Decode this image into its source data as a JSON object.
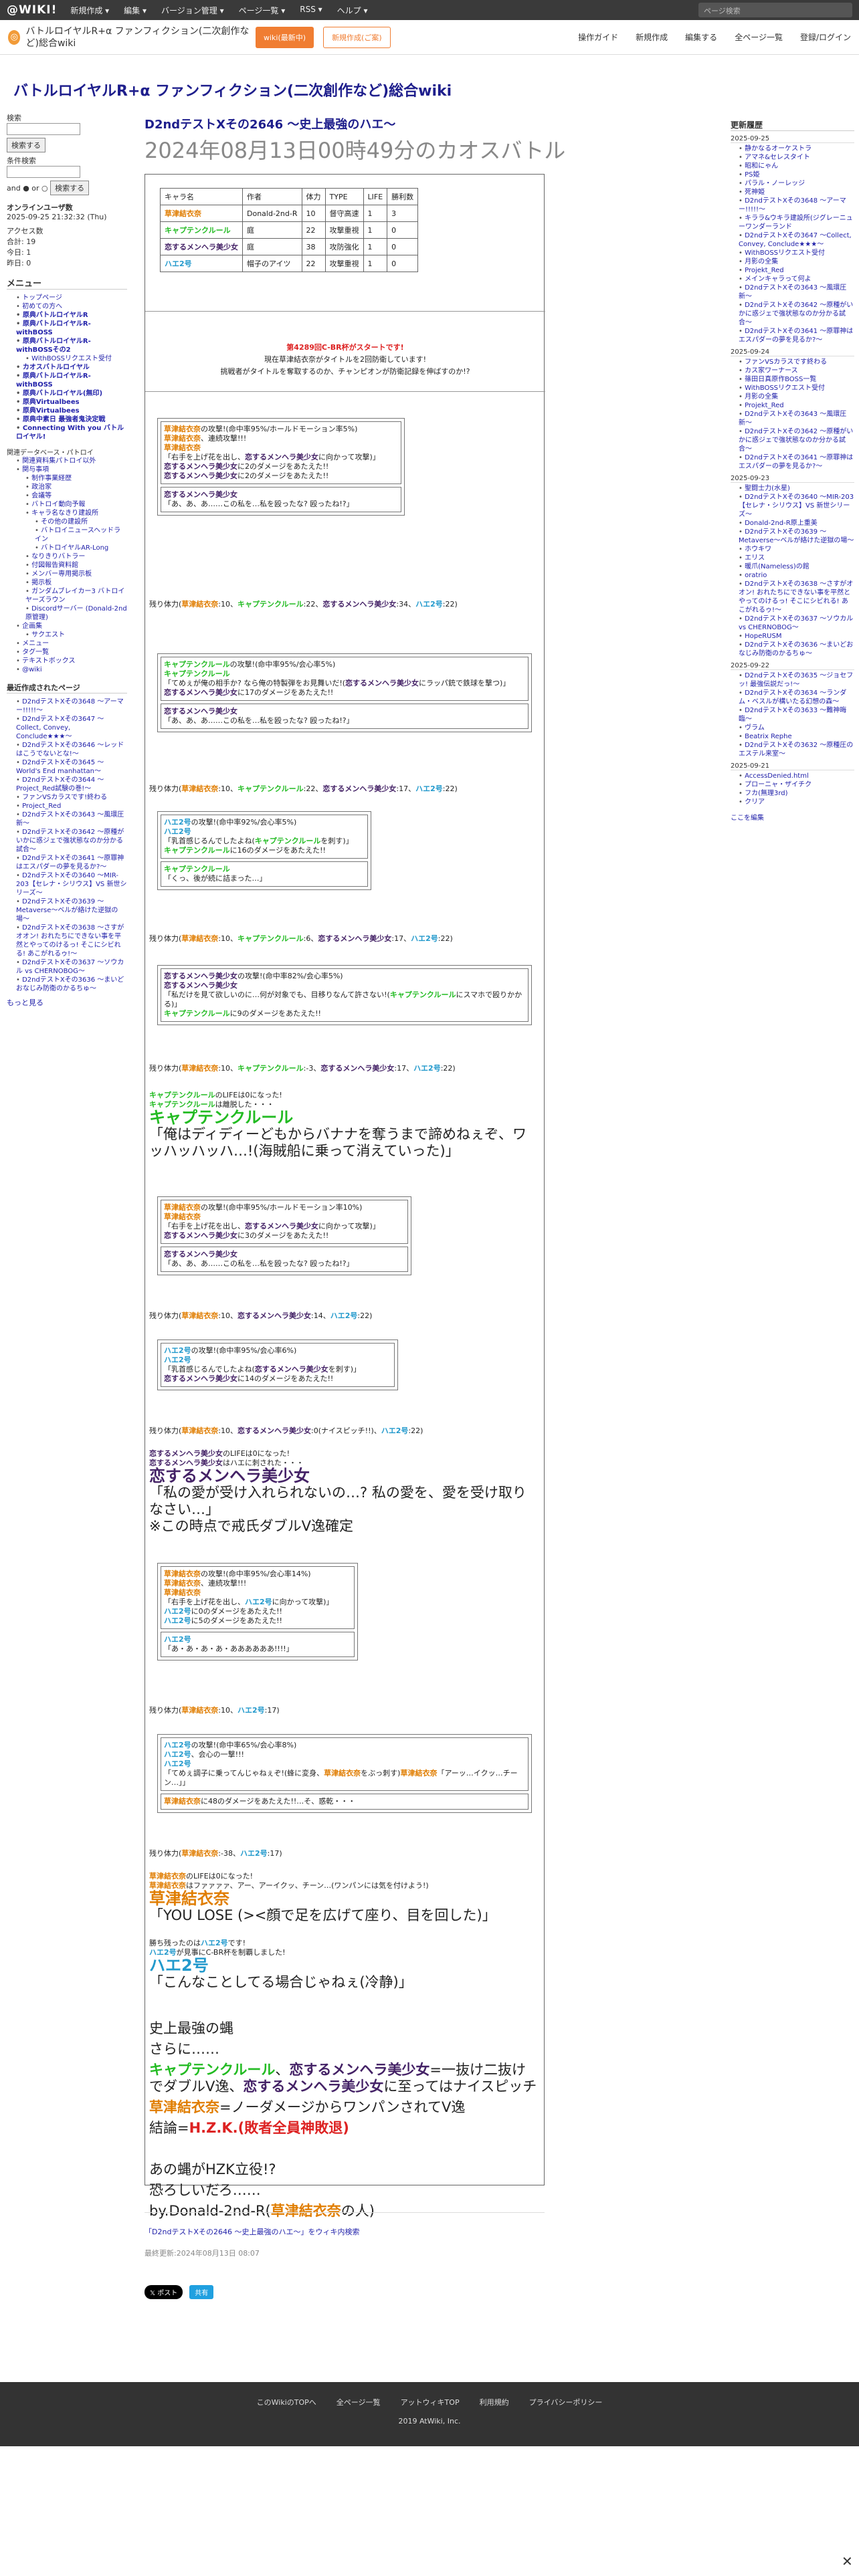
{
  "topbar": {
    "logo": "@WIKI!",
    "menu": [
      "新規作成 ▾",
      "編集 ▾",
      "バージョン管理 ▾",
      "ページ一覧 ▾",
      "RSS ▾",
      "ヘルプ ▾"
    ],
    "search_placeholder": "ページ検索"
  },
  "subbar": {
    "wiki_name": "バトルロイヤルR+α ファンフィクション(二次創作など)総合wiki",
    "btn1": "wiki(最新中)",
    "btn2": "新規作成(ご案)",
    "actions": [
      "操作ガイド",
      "新規作成",
      "編集する",
      "全ページ一覧",
      "登録/ログイン"
    ]
  },
  "wiki_title": "バトルロイヤルR+α ファンフィクション(二次創作など)総合wiki",
  "left": {
    "search_label": "検索",
    "search_btn": "検索する",
    "sub_label": "条件検索",
    "and_or": "and ● or ○",
    "online_label": "オンラインユーザ数",
    "online_time": "2025-09-25 21:32:32 (Thu)",
    "access": [
      "アクセス数",
      "合計: 19",
      "今日: 1",
      "昨日: 0"
    ],
    "menu_title": "メニュー",
    "menu": [
      [
        "トップページ",
        ""
      ],
      [
        "初めての方へ",
        ""
      ],
      [
        "原典バトルロイヤルR",
        ""
      ],
      [
        "原典バトルロイヤルR-withBOSS",
        ""
      ],
      [
        "原典バトルロイヤルR-withBOSSその2",
        ""
      ],
      [
        "WithBOSSリクエスト受付",
        "s2"
      ],
      [
        "カオスバトルロイヤル",
        ""
      ],
      [
        "原典バトルロイヤルR-withBOSS",
        ""
      ],
      [
        "原典バトルロイヤル(無印)",
        ""
      ],
      [
        "原典Virtualbees",
        ""
      ],
      [
        "原典Virtualbees",
        ""
      ],
      [
        "原典中素日 最強者鬼決定戦",
        ""
      ],
      [
        "Connecting With you バトルロイヤル!",
        ""
      ]
    ],
    "tree_title": "関連データベース・パトロイ",
    "tree": [
      [
        "関連資料集パトロイ以外",
        ""
      ],
      [
        "関与事項",
        ""
      ],
      [
        "制作事業経歴",
        "s2"
      ],
      [
        "政治家",
        "s2"
      ],
      [
        "会議等",
        "s2"
      ],
      [
        "バトロイ動向予報",
        "s2"
      ],
      [
        "キャラ名なきり建設所",
        "s2"
      ],
      [
        "その他の建設所",
        "s3"
      ],
      [
        "バトロイニュースヘッドライン",
        "s3"
      ],
      [
        "バトロイヤルAR-Long",
        "s3"
      ],
      [
        "なりきりバトラー",
        "s2"
      ],
      [
        "付図報告資料館",
        "s2"
      ],
      [
        "メンバー専用掲示板",
        "s2"
      ],
      [
        "掲示板",
        "s2"
      ],
      [
        "ガンダムブレイカー3 バトロイヤーズラウン",
        "s2"
      ],
      [
        "Discordサーバー (Donald-2nd原管理)",
        "s2"
      ],
      [
        "企画集",
        ""
      ],
      [
        "サクエスト",
        "s2"
      ],
      [
        "メニュー",
        ""
      ],
      [
        "タグ一覧",
        ""
      ],
      [
        "テキストボックス",
        ""
      ],
      [
        "@wiki",
        ""
      ]
    ],
    "recent_title": "最近作成されたページ",
    "recent": [
      "D2ndテストXその3648 〜アーマー!!!!!〜",
      "D2ndテストXその3647 〜Collect, Convey, Conclude★★★〜",
      "D2ndテストXその3646 〜レッドはこうでないとな!〜",
      "D2ndテストXその3645 〜World's End manhattan〜",
      "D2ndテストXその3644 〜Project_Red試験の巻!〜",
      "ファンVSカラスです!終わる",
      "Project_Red",
      "D2ndテストXその3643 〜風環圧新〜",
      "D2ndテストXその3642 〜原種がいかに惑ジェで強状態なのか分かる試合〜",
      "D2ndテストXその3641 〜原罪神はエスパダーの夢を見るか?〜",
      "D2ndテストXその3640 〜MIR-203【セレナ・シリウス】VS 新世シリーズ〜",
      "D2ndテストXその3639 〜Metaverse〜ベルが絡けた逆獄の場〜",
      "D2ndテストXその3638 〜さすがオオン! おれたちにできない事を平然とやってのけるっ! そこにシビれる! あこがれるゥ!〜",
      "D2ndテストXその3637 〜ソウカル vs CHERNOBOG〜",
      "D2ndテストXその3636 〜まいどおなじみ防衛のかるちゅ〜"
    ],
    "more": "もっと見る"
  },
  "right": {
    "title": "更新履歴",
    "groups": [
      {
        "date": "2025-09-25",
        "items": [
          "静かなるオーケストラ",
          "アマネ&セレスタイト",
          "昭和にゃん",
          "PS姫",
          "パラル・ノーレッジ",
          "死神姫",
          "D2ndテストXその3648 〜アーマー!!!!!〜",
          "キララ&ウキラ建設所(ジグレーニューワンダーランド",
          "D2ndテストXその3647 〜Collect, Convey, Conclude★★★〜",
          "WithBOSSリクエスト受付",
          "月影の全集",
          "Projekt_Red",
          "メインキャラって何よ",
          "D2ndテストXその3643 〜風環圧新〜",
          "D2ndテストXその3642 〜原種がいかに惑ジェで強状態なのか分かる試合〜",
          "D2ndテストXその3641 〜原罪神はエスパダーの夢を見るか?〜"
        ]
      },
      {
        "date": "2025-09-24",
        "items": [
          "ファンVSカラスです終わる",
          "カス家ワーナース",
          "篠田日真原作BOSS一覧",
          "WithBOSSリクエスト受付",
          "月影の全集",
          "Projekt_Red",
          "D2ndテストXその3643 〜風環圧新〜",
          "D2ndテストXその3642 〜原種がいかに惑ジェで強状態なのか分かる試合〜",
          "D2ndテストXその3641 〜原罪神はエスパダーの夢を見るか?〜"
        ]
      },
      {
        "date": "2025-09-23",
        "items": [
          "聖闘士力(水星)",
          "D2ndテストXその3640 〜MIR-203【セレナ・シリウス】VS 新世シリーズ〜",
          "Donald-2nd-R原上重美",
          "D2ndテストXその3639 〜Metaverse〜ベルが絡けた逆獄の場〜",
          "ホウキワ",
          "エリス",
          "暖爪(Nameless)の館",
          "oratrio",
          "D2ndテストXその3638 〜さすがオオン! おれたちにできない事を平然とやってのけるっ! そこにシビれる! あこがれるゥ!〜",
          "D2ndテストXその3637 〜ソウカル vs CHERNOBOG〜",
          "HopeRUSM",
          "D2ndテストXその3636 〜まいどおなじみ防衛のかるちゅ〜"
        ]
      },
      {
        "date": "2025-09-22",
        "items": [
          "D2ndテストXその3635 〜ジョセフッ! 最強伝説だっ!〜",
          "D2ndテストXその3634 〜ランダム・ベスルが構いたる幻想の森〜",
          "D2ndテストXその3633 〜難神晦臨〜",
          "ヴラム",
          "Beatrix Rephe",
          "D2ndテストXその3632 〜原種圧のエステル来室〜"
        ]
      },
      {
        "date": "2025-09-21",
        "items": [
          "AccessDenied.html",
          "プローニャ・ザイチク",
          "フカ(無理3rd)",
          "クリア"
        ]
      }
    ],
    "more": "ここを編集"
  },
  "page": {
    "title": "D2ndテストXその2646 〜史上最強のハエ〜",
    "subtitle": "2024年08月13日00時49分のカオスバトル"
  },
  "table": {
    "head": [
      "キャラ名",
      "作者",
      "体力",
      "TYPE",
      "LIFE",
      "勝利数"
    ],
    "rows": [
      [
        "草津結衣奈",
        "Donald-2nd-R",
        "10",
        "督守高速",
        "1",
        "3"
      ],
      [
        "キャプテンクルール",
        "庭",
        "22",
        "攻撃重視",
        "1",
        "0"
      ],
      [
        "恋するメンヘラ美少女",
        "庭",
        "38",
        "攻防強化",
        "1",
        "0"
      ],
      [
        "ハエ2号",
        "帽子のアイツ",
        "22",
        "攻撃重視",
        "1",
        "0"
      ]
    ]
  },
  "intro": {
    "line1": "第4289回C-BR杯がスタートです!",
    "line2": "現在草津結衣奈がタイトルを2回防衛しています!",
    "line3": "挑戦者がタイトルを奪取するのか、チャンピオンが防衛記録を伸ばすのか!?"
  },
  "b1": [
    "草津結衣奈の攻撃!(命中率95%/ホールドモーション率5%)",
    "草津結衣奈、連続攻撃!!!",
    "草津結衣奈",
    "「右手を上げ花を出し、恋するメンヘラ美少女に向かって攻撃)」",
    "恋するメンヘラ美少女に2のダメージをあたえた!!",
    "恋するメンヘラ美少女に2のダメージをあたえた!!",
    "恋するメンヘラ美少女",
    "「あ、あ、あ……この私を…私を殴ったな? 殴ったね!?」"
  ],
  "r1": "残り体力(草津結衣奈:10、キャプテンクルール:22、恋するメンヘラ美少女:34、ハエ2号:22)",
  "b2": [
    "キャプテンクルールの攻撃!(命中率95%/会心率5%)",
    "キャプテンクルール",
    "「てめぇが俺の相手か? なら俺の特製弾をお見舞いだ!(恋するメンヘラ美少女にラッパ銃で鉄球を撃つ)」",
    "恋するメンヘラ美少女に17のダメージをあたえた!!",
    "恋するメンヘラ美少女",
    "「あ、あ、あ……この私を…私を殴ったな? 殴ったね!?」"
  ],
  "r2": "残り体力(草津結衣奈:10、キャプテンクルール:22、恋するメンヘラ美少女:17、ハエ2号:22)",
  "b3": [
    "ハエ2号の攻撃!(命中率92%/会心率5%)",
    "ハエ2号",
    "「乳首感じるんでしたよね(キャプテンクルールを刺す)」",
    "キャプテンクルールに16のダメージをあたえた!!",
    "キャプテンクルール",
    "「くっ、後が続に詰まった…」"
  ],
  "r3": "残り体力(草津結衣奈:10、キャプテンクルール:6、恋するメンヘラ美少女:17、ハエ2号:22)",
  "b4": [
    "恋するメンヘラ美少女の攻撃!(命中率82%/会心率5%)",
    "恋するメンヘラ美少女",
    "「私だけを見て欲しいのに…何が対象でも、目移りなんて許さない!(キャプテンクルールにスマホで殴りかかる)」",
    "キャプテンクルールに9のダメージをあたえた!!"
  ],
  "r4": "残り体力(草津結衣奈:10、キャプテンクルール:-3、恋するメンヘラ美少女:17、ハエ2号:22)",
  "e1": [
    "キャプテンクルールのLIFEは0になった!",
    "キャプテンクルールは離脱した・・・",
    "キャプテンクルール",
    "「俺はディディーどもからバナナを奪うまで諦めねぇぞ、ワッハッハッハ…!(海賊船に乗って消えていった)」"
  ],
  "b5": [
    "草津結衣奈の攻撃!(命中率95%/ホールドモーション率10%)",
    "草津結衣奈",
    "「右手を上げ花を出し、恋するメンヘラ美少女に向かって攻撃)」",
    "恋するメンヘラ美少女に3のダメージをあたえた!!",
    "恋するメンヘラ美少女",
    "「あ、あ、あ……この私を…私を殴ったな? 殴ったね!?」"
  ],
  "r5": "残り体力(草津結衣奈:10、恋するメンヘラ美少女:14、ハエ2号:22)",
  "b6": [
    "ハエ2号の攻撃!(命中率95%/会心率6%)",
    "ハエ2号",
    "「乳首感じるんでしたよね(恋するメンヘラ美少女を刺す)」",
    "恋するメンヘラ美少女に14のダメージをあたえた!!"
  ],
  "r6": "残り体力(草津結衣奈:10、恋するメンヘラ美少女:0(ナイスピッチ!!)、ハエ2号:22)",
  "e2": [
    "恋するメンヘラ美少女のLIFEは0になった!",
    "恋するメンヘラ美少女はハエに刺された・・・",
    "恋するメンヘラ美少女",
    "「私の愛が受け入れられないの…? 私の愛を、愛を受け取りなさい…」",
    "※この時点で戒氏ダブルV逸確定"
  ],
  "b7": [
    "草津結衣奈の攻撃!(命中率95%/会心率14%)",
    "草津結衣奈、連続攻撃!!!",
    "草津結衣奈",
    "「右手を上げ花を出し、ハエ2号に向かって攻撃)」",
    "ハエ2号に0のダメージをあたえた!!",
    "ハエ2号に5のダメージをあたえた!!",
    "ハエ2号",
    "「あ・あ・あ・あ・ああああああ!!!!」"
  ],
  "r7": "残り体力(草津結衣奈:10、ハエ2号:17)",
  "b8": [
    "ハエ2号の攻撃!(命中率65%/会心率8%)",
    "ハエ2号、会心の一撃!!!",
    "ハエ2号",
    "「てめぇ調子に乗ってんじゃねぇぞ!(蜂に変身、草津結衣奈をぶっ刺す)草津結衣奈「アーッ…イクッ…チーン…」」",
    "草津結衣奈に48のダメージをあたえた!!…そ、惑乾・・・"
  ],
  "r8": "残り体力(草津結衣奈:-38、ハエ2号:17)",
  "e3": [
    "草津結衣奈のLIFEは0になった!",
    "草津結衣奈はファァァァ、アー、アーイクッ、チーン…(ワンパンには気を付けよう!)",
    "草津結衣奈",
    "「YOU LOSE (><顔で足を広げて座り、目を回した)」"
  ],
  "e4": [
    "勝ち残ったのはハエ2号です!",
    "ハエ2号が見事にC-BR杯を制覇しました!",
    "ハエ2号",
    "「こんなことしてる場合じゃねぇ(冷静)」"
  ],
  "e5": [
    "史上最強の蝿",
    "さらに……",
    "キャプテンクルール、恋するメンヘラ美少女=一抜け二抜けでダブルV逸、恋するメンヘラ美少女に至ってはナイスピッチ",
    "草津結衣奈=ノーダメージからワンパンされてV逸",
    "結論=H.Z.K.(敗者全員神敗退)",
    "",
    "あの蝿がHZK立役!?",
    "恐ろしいだろ……",
    "by.Donald-2nd-R(草津結衣奈の人)"
  ],
  "below": {
    "link": "「D2ndテストXその2646 〜史上最強のハエ〜」をウィキ内検索",
    "updated": "最終更新:2024年08月13日 08:07",
    "post": "𝕏 ポスト",
    "share": "共有"
  },
  "footer": {
    "links": [
      "このWikiのTOPへ",
      "全ページ一覧",
      "アットウィキTOP",
      "利用規約",
      "プライバシーポリシー"
    ],
    "copy": "2019 AtWiki, Inc."
  },
  "colors": {
    "yui": "#e07d00",
    "kru": "#22bb22",
    "men": "#442266",
    "hae": "#2299cc",
    "red": "#dd2222"
  }
}
